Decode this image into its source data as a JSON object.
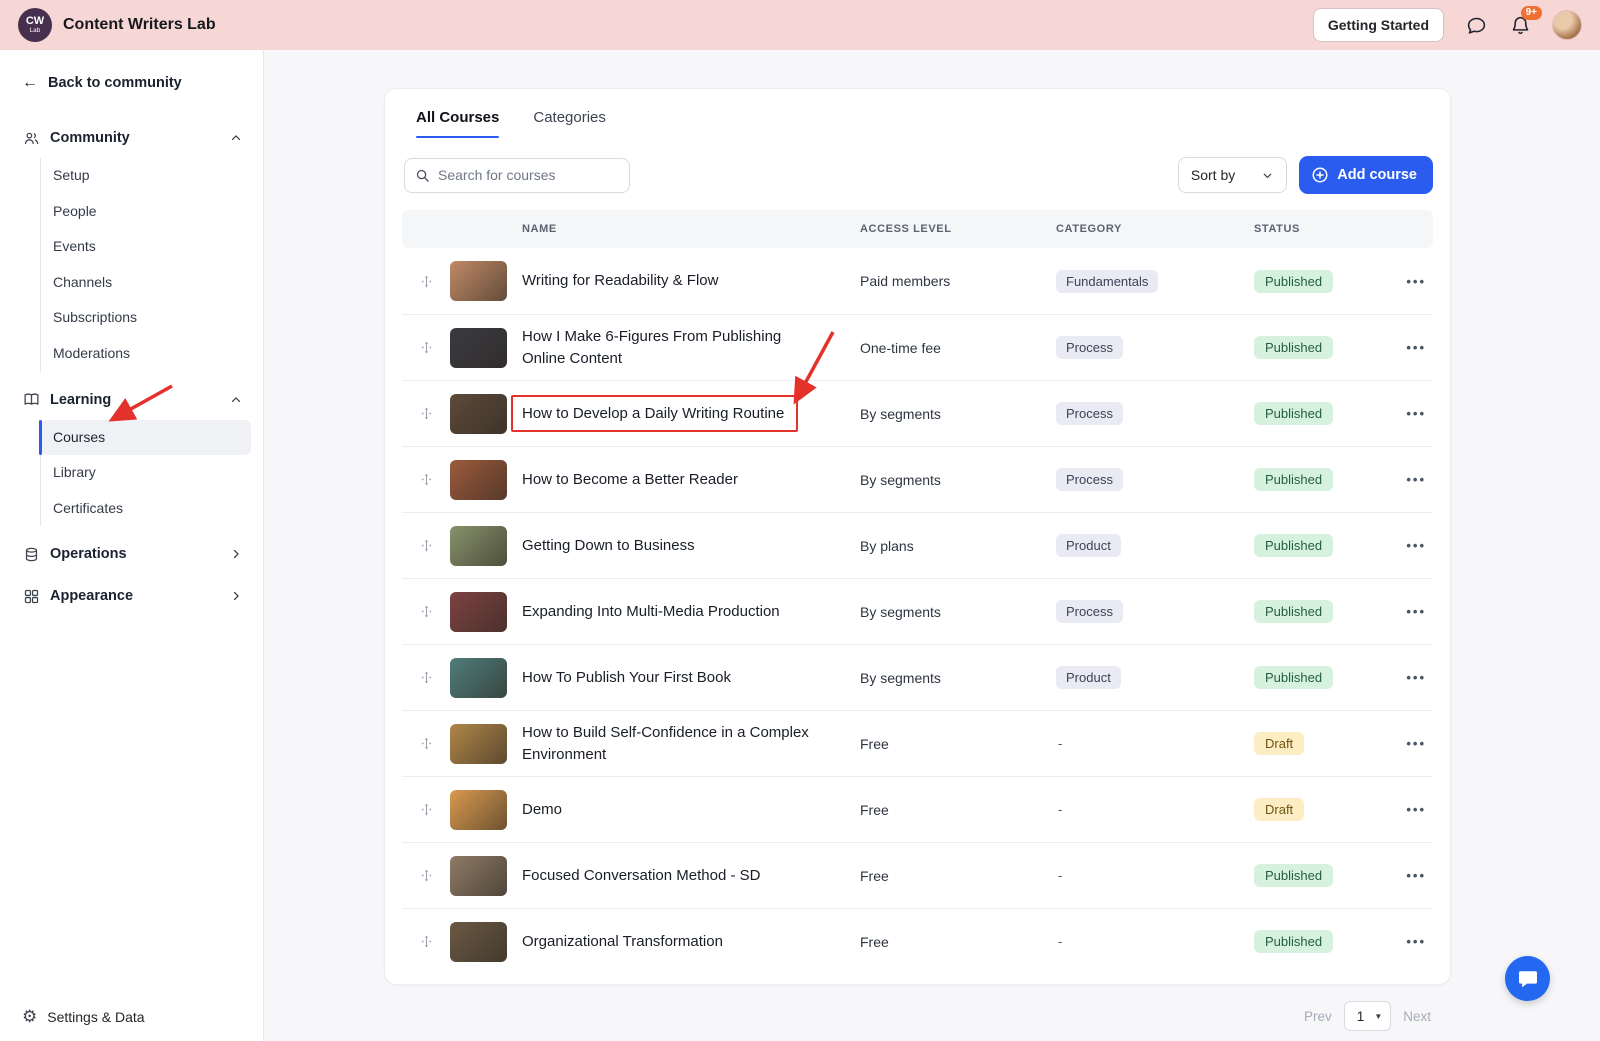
{
  "colors": {
    "header_bg": "#f7d6d6",
    "accent_blue": "#2b5cf0",
    "published_bg": "#d6f2de",
    "draft_bg": "#fcedc4",
    "annotation_red": "#e5312b"
  },
  "header": {
    "logo_line1": "CW",
    "logo_line2": "Lab",
    "title": "Content Writers Lab",
    "getting_started_label": "Getting Started",
    "notification_count": "9+"
  },
  "sidebar": {
    "back_label": "Back to community",
    "community": {
      "label": "Community",
      "items": [
        "Setup",
        "People",
        "Events",
        "Channels",
        "Subscriptions",
        "Moderations"
      ]
    },
    "learning": {
      "label": "Learning",
      "items": [
        "Courses",
        "Library",
        "Certificates"
      ],
      "selected_item": "Courses"
    },
    "operations_label": "Operations",
    "appearance_label": "Appearance",
    "settings_label": "Settings & Data"
  },
  "main": {
    "tabs": {
      "all_courses": "All Courses",
      "categories": "Categories"
    },
    "search_placeholder": "Search for courses",
    "sort_by_label": "Sort by",
    "add_course_label": "Add course",
    "table": {
      "headers": {
        "name": "NAME",
        "access": "ACCESS LEVEL",
        "category": "CATEGORY",
        "status": "STATUS"
      },
      "rows": [
        {
          "name": "Writing for Readability & Flow",
          "access": "Paid members",
          "category": "Fundamentals",
          "status": "Published",
          "thumb_color": "#c08a66",
          "highlight": false
        },
        {
          "name": "How I Make 6-Figures From Publishing Online Content",
          "access": "One-time fee",
          "category": "Process",
          "status": "Published",
          "thumb_color": "#3a3a40",
          "highlight": false
        },
        {
          "name": "How to Develop a Daily Writing Routine",
          "access": "By segments",
          "category": "Process",
          "status": "Published",
          "thumb_color": "#5d4a3a",
          "highlight": true
        },
        {
          "name": "How to Become a Better Reader",
          "access": "By segments",
          "category": "Process",
          "status": "Published",
          "thumb_color": "#9c5a3c",
          "highlight": false
        },
        {
          "name": "Getting Down to Business",
          "access": "By plans",
          "category": "Product",
          "status": "Published",
          "thumb_color": "#87926b",
          "highlight": false
        },
        {
          "name": "Expanding Into Multi-Media Production",
          "access": "By segments",
          "category": "Process",
          "status": "Published",
          "thumb_color": "#7d4242",
          "highlight": false
        },
        {
          "name": "How To Publish Your First Book",
          "access": "By segments",
          "category": "Product",
          "status": "Published",
          "thumb_color": "#4f7d7a",
          "highlight": false
        },
        {
          "name": "How to Build Self-Confidence in a Complex Environment",
          "access": "Free",
          "category": "-",
          "status": "Draft",
          "thumb_color": "#b08648",
          "highlight": false
        },
        {
          "name": "Demo",
          "access": "Free",
          "category": "-",
          "status": "Draft",
          "thumb_color": "#d99a4e",
          "highlight": false
        },
        {
          "name": "Focused Conversation Method - SD",
          "access": "Free",
          "category": "-",
          "status": "Published",
          "thumb_color": "#8d7b66",
          "highlight": false
        },
        {
          "name": "Organizational Transformation",
          "access": "Free",
          "category": "-",
          "status": "Published",
          "thumb_color": "#6b5a44",
          "highlight": false
        }
      ]
    },
    "pagination": {
      "prev_label": "Prev",
      "page_value": "1",
      "next_label": "Next"
    }
  }
}
